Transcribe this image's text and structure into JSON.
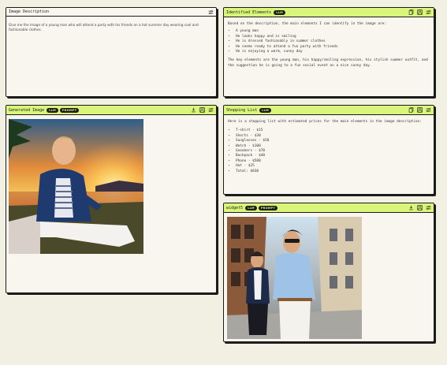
{
  "description_panel": {
    "title": "Image Description",
    "text": "Give me the image of a young man who will attend a party with his friends on a hot summer day wearing cool and fashionable clothes.",
    "icon": "settings-sliders-icon"
  },
  "identified_panel": {
    "title": "Identified Elements",
    "badge": "LLM",
    "intro": "Based on the description, the main elements I can identify in the image are:",
    "items": [
      "A young man",
      "He looks happy and is smiling",
      "He is dressed fashionably in summer clothes",
      "He seems ready to attend a fun party with friends",
      "He is enjoying a warm, sunny day"
    ],
    "outro": "The key elements are the young man, his happy/smiling expression, his stylish summer outfit, and the suggestion he is going to a fun social event on a nice sunny day."
  },
  "generated_panel": {
    "title": "Generated Image",
    "badges": [
      "LLM",
      "PROMPT"
    ]
  },
  "shopping_panel": {
    "title": "Shopping List",
    "badge": "LLM",
    "intro": "Here is a shopping list with estimated prices for the main elements in the image description:",
    "items": [
      "T-shirt - $15",
      "Shorts - $30",
      "Sunglasses - $50",
      "Watch - $100",
      "Sneakers - $70",
      "Backpack - $40",
      "Phone - $500",
      "Hat - $25",
      "Total: $830"
    ]
  },
  "widget_panel": {
    "title": "widget5",
    "badges": [
      "LLM",
      "PROMPT"
    ]
  },
  "colors": {
    "accent": "#d9f57a",
    "background": "#f2efe3",
    "panel": "#f8f6ef",
    "border": "#1b1b1b"
  }
}
